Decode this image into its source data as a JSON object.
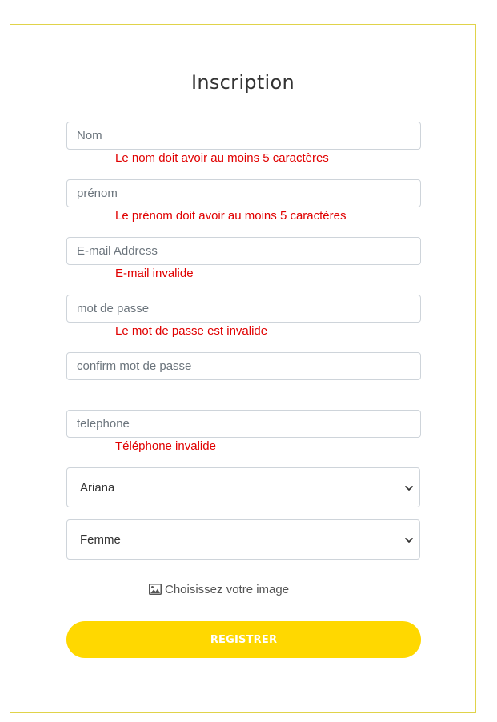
{
  "form": {
    "title": "Inscription",
    "fields": {
      "nom": {
        "placeholder": "Nom",
        "value": "",
        "error": "Le nom doit avoir au moins 5 caractères"
      },
      "prenom": {
        "placeholder": "prénom",
        "value": "",
        "error": "Le prénom doit avoir au moins 5 caractères"
      },
      "email": {
        "placeholder": "E-mail Address",
        "value": "",
        "error": "E-mail invalide"
      },
      "password": {
        "placeholder": "mot de passe",
        "value": "",
        "error": "Le mot de passe est invalide"
      },
      "confirm_password": {
        "placeholder": "confirm mot de passe",
        "value": ""
      },
      "telephone": {
        "placeholder": "telephone",
        "value": "",
        "error": "Téléphone invalide"
      }
    },
    "city_select": {
      "selected": "Ariana",
      "icon": "chevron-down-icon"
    },
    "gender_select": {
      "selected": "Femme",
      "icon": "chevron-down-icon"
    },
    "image_upload": {
      "label": "Choisissez votre image",
      "icon": "image-icon"
    },
    "submit_label": "REGISTRER"
  },
  "colors": {
    "accent": "#ffd800",
    "card_border": "#e0d34a",
    "error": "#e00000",
    "input_border": "#ced4da"
  }
}
